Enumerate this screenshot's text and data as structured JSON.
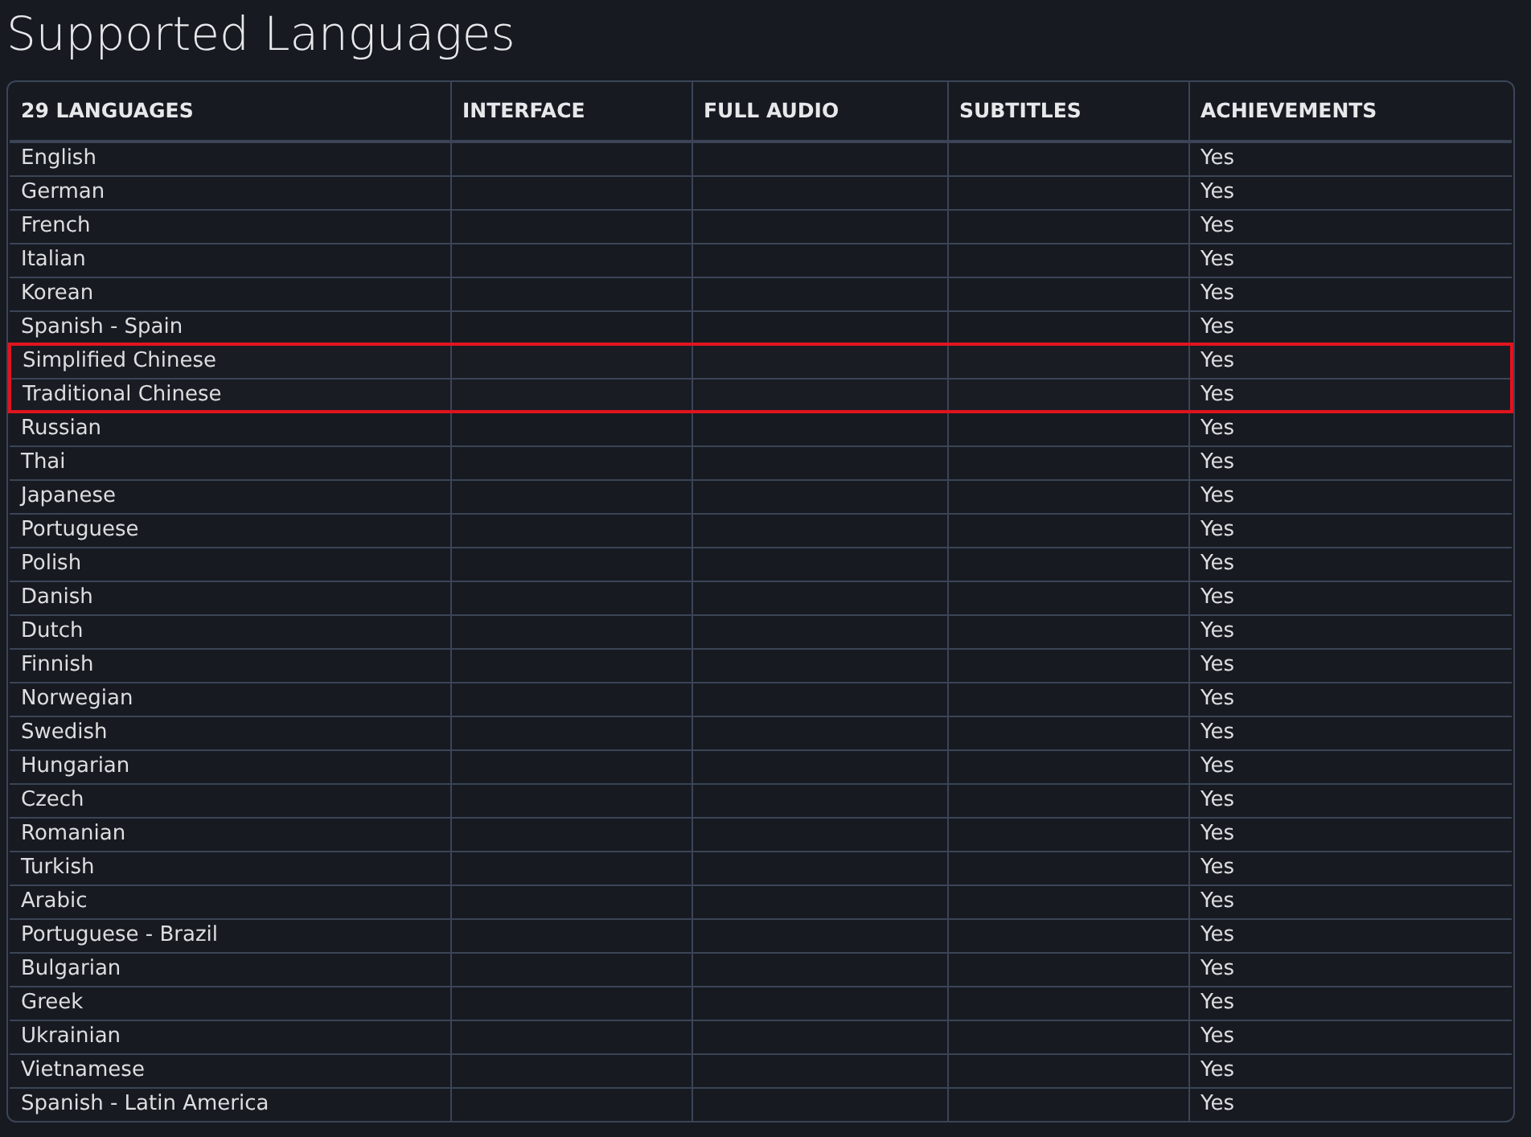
{
  "title": "Supported Languages",
  "table": {
    "columns": [
      "29 LANGUAGES",
      "INTERFACE",
      "FULL AUDIO",
      "SUBTITLES",
      "ACHIEVEMENTS"
    ],
    "rows": [
      {
        "language": "English",
        "achievements": "Yes",
        "highlighted": false
      },
      {
        "language": "German",
        "achievements": "Yes",
        "highlighted": false
      },
      {
        "language": "French",
        "achievements": "Yes",
        "highlighted": false
      },
      {
        "language": "Italian",
        "achievements": "Yes",
        "highlighted": false
      },
      {
        "language": "Korean",
        "achievements": "Yes",
        "highlighted": false
      },
      {
        "language": "Spanish - Spain",
        "achievements": "Yes",
        "highlighted": false
      },
      {
        "language": "Simplified Chinese",
        "achievements": "Yes",
        "highlighted": true
      },
      {
        "language": "Traditional Chinese",
        "achievements": "Yes",
        "highlighted": true
      },
      {
        "language": "Russian",
        "achievements": "Yes",
        "highlighted": false
      },
      {
        "language": "Thai",
        "achievements": "Yes",
        "highlighted": false
      },
      {
        "language": "Japanese",
        "achievements": "Yes",
        "highlighted": false
      },
      {
        "language": "Portuguese",
        "achievements": "Yes",
        "highlighted": false
      },
      {
        "language": "Polish",
        "achievements": "Yes",
        "highlighted": false
      },
      {
        "language": "Danish",
        "achievements": "Yes",
        "highlighted": false
      },
      {
        "language": "Dutch",
        "achievements": "Yes",
        "highlighted": false
      },
      {
        "language": "Finnish",
        "achievements": "Yes",
        "highlighted": false
      },
      {
        "language": "Norwegian",
        "achievements": "Yes",
        "highlighted": false
      },
      {
        "language": "Swedish",
        "achievements": "Yes",
        "highlighted": false
      },
      {
        "language": "Hungarian",
        "achievements": "Yes",
        "highlighted": false
      },
      {
        "language": "Czech",
        "achievements": "Yes",
        "highlighted": false
      },
      {
        "language": "Romanian",
        "achievements": "Yes",
        "highlighted": false
      },
      {
        "language": "Turkish",
        "achievements": "Yes",
        "highlighted": false
      },
      {
        "language": "Arabic",
        "achievements": "Yes",
        "highlighted": false
      },
      {
        "language": "Portuguese - Brazil",
        "achievements": "Yes",
        "highlighted": false
      },
      {
        "language": "Bulgarian",
        "achievements": "Yes",
        "highlighted": false
      },
      {
        "language": "Greek",
        "achievements": "Yes",
        "highlighted": false
      },
      {
        "language": "Ukrainian",
        "achievements": "Yes",
        "highlighted": false
      },
      {
        "language": "Vietnamese",
        "achievements": "Yes",
        "highlighted": false
      },
      {
        "language": "Spanish - Latin America",
        "achievements": "Yes",
        "highlighted": false
      }
    ]
  }
}
